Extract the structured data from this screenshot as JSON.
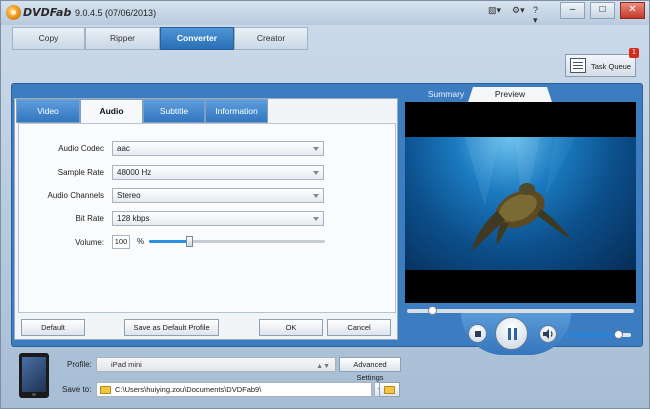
{
  "app": {
    "logo_text": "DVDFab",
    "version": "9.0.4.5 (07/06/2013)"
  },
  "title_icons": {
    "menu": "▧▾",
    "settings": "⚙▾",
    "help": "?▾"
  },
  "window_controls": {
    "minimize": "–",
    "maximize": "□",
    "close": "✕"
  },
  "main_tabs": [
    {
      "label": "Copy",
      "active": false
    },
    {
      "label": "Ripper",
      "active": false
    },
    {
      "label": "Converter",
      "active": true
    },
    {
      "label": "Creator",
      "active": false
    }
  ],
  "task_queue": {
    "label": "Task Queue",
    "badge": "1"
  },
  "sub_tabs": [
    {
      "label": "Video",
      "active": false
    },
    {
      "label": "Audio",
      "active": true
    },
    {
      "label": "Subtitle",
      "active": false
    },
    {
      "label": "Information",
      "active": false
    }
  ],
  "audio": {
    "codec_label": "Audio Codec",
    "codec_value": "aac",
    "sample_rate_label": "Sample Rate",
    "sample_rate_value": "48000 Hz",
    "channels_label": "Audio Channels",
    "channels_value": "Stereo",
    "bitrate_label": "Bit Rate",
    "bitrate_value": "128 kbps",
    "volume_label": "Volume:",
    "volume_value": "100",
    "volume_unit": "%",
    "volume_slider_fraction": 0.23
  },
  "buttons": {
    "default": "Default",
    "save_default": "Save as Default Profile",
    "ok": "OK",
    "cancel": "Cancel"
  },
  "preview": {
    "tabs": [
      {
        "label": "Summary",
        "active": false
      },
      {
        "label": "Preview",
        "active": true
      }
    ],
    "seek_fraction": 0.11,
    "volume_fraction": 0.8
  },
  "bottom": {
    "profile_label": "Profile:",
    "profile_value": "iPad mini",
    "advanced_label": "Advanced Settings",
    "saveto_label": "Save to:",
    "saveto_value": "C:\\Users\\huiying.zou\\Documents\\DVDFab9\\"
  },
  "colors": {
    "accent": "#3c7cc1",
    "active_tab": "#2a6fb6",
    "badge": "#d62c1a",
    "slider": "#2d8fe0"
  }
}
